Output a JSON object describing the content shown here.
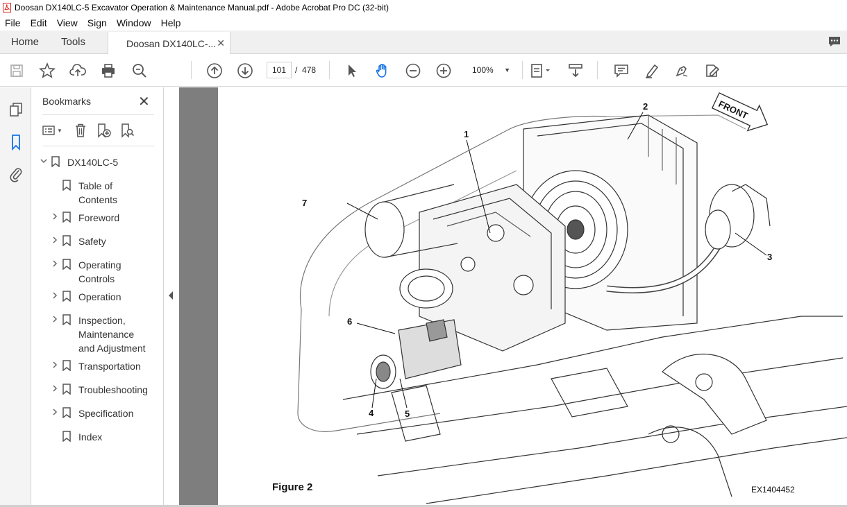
{
  "window": {
    "title": "Doosan DX140LC-5 Excavator Operation & Maintenance Manual.pdf - Adobe Acrobat Pro DC (32-bit)"
  },
  "menu": [
    "File",
    "Edit",
    "View",
    "Sign",
    "Window",
    "Help"
  ],
  "tabs": {
    "home": "Home",
    "tools": "Tools",
    "document": "Doosan DX140LC-..."
  },
  "toolbar": {
    "current_page": "101",
    "page_separator": "/",
    "total_pages": "478",
    "zoom": "100%"
  },
  "bookmarks": {
    "header": "Bookmarks",
    "root": "DX140LC-5",
    "items": [
      {
        "label": "Table of Contents",
        "lines": [
          "Table of",
          "Contents"
        ],
        "expandable": false
      },
      {
        "label": "Foreword",
        "lines": [
          "Foreword"
        ],
        "expandable": true
      },
      {
        "label": "Safety",
        "lines": [
          "Safety"
        ],
        "expandable": true
      },
      {
        "label": "Operating Controls",
        "lines": [
          "Operating",
          "Controls"
        ],
        "expandable": true
      },
      {
        "label": "Operation",
        "lines": [
          "Operation"
        ],
        "expandable": true
      },
      {
        "label": "Inspection, Maintenance and Adjustment",
        "lines": [
          "Inspection,",
          "Maintenance",
          "and Adjustment"
        ],
        "expandable": true
      },
      {
        "label": "Transportation",
        "lines": [
          "Transportation"
        ],
        "expandable": true
      },
      {
        "label": "Troubleshooting",
        "lines": [
          "Troubleshooting"
        ],
        "expandable": true
      },
      {
        "label": "Specification",
        "lines": [
          "Specification"
        ],
        "expandable": true
      },
      {
        "label": "Index",
        "lines": [
          "Index"
        ],
        "expandable": false
      }
    ]
  },
  "document": {
    "figure_caption": "Figure 2",
    "figure_code": "EX1404452",
    "front_label": "FRONT",
    "callouts": [
      "1",
      "2",
      "3",
      "4",
      "5",
      "6",
      "7"
    ]
  },
  "colors": {
    "accent_blue": "#1473e6",
    "toolbar_icon": "#555555",
    "viewer_bg": "#7e7e7e",
    "acrobat_red": "#d9251c"
  }
}
